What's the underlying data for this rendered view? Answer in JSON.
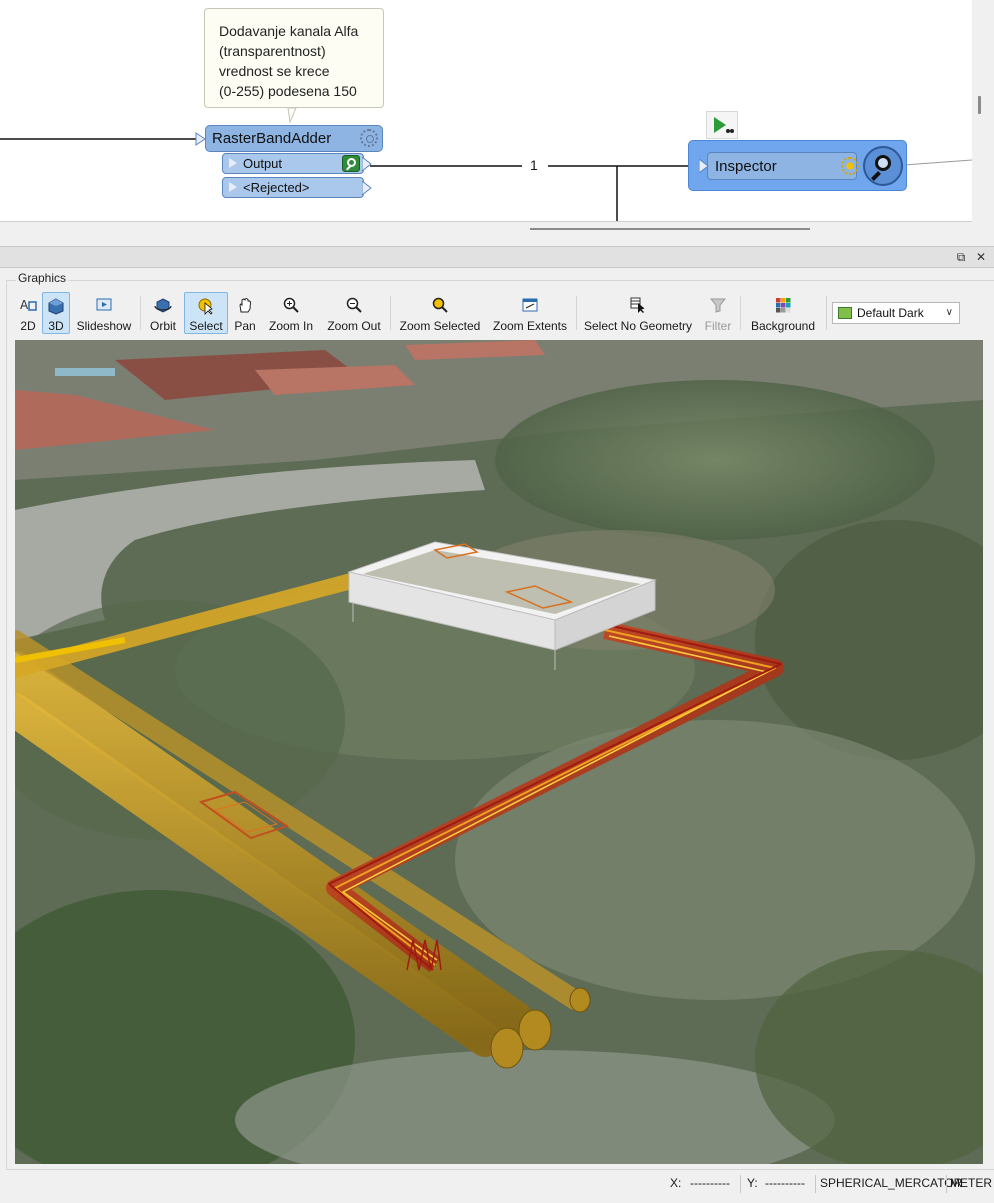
{
  "workflow": {
    "annotation": "Dodavanje kanala Alfa\n(transparentnost)\nvrednost se krece\n(0-255) podesena 150",
    "raster_band_adder": {
      "title": "RasterBandAdder",
      "ports": [
        "Output",
        "<Rejected>"
      ]
    },
    "connection_count": "1",
    "inspector": {
      "title": "Inspector"
    }
  },
  "graphics_panel": {
    "group_label": "Graphics",
    "toolbar": {
      "mode_2d": "2D",
      "mode_3d": "3D",
      "slideshow": "Slideshow",
      "orbit": "Orbit",
      "select": "Select",
      "pan": "Pan",
      "zoom_in": "Zoom In",
      "zoom_out": "Zoom Out",
      "zoom_selected": "Zoom Selected",
      "zoom_extents": "Zoom Extents",
      "select_no_geometry": "Select No Geometry",
      "filter": "Filter",
      "background": "Background"
    },
    "background_select": {
      "selected": "Default Dark"
    }
  },
  "status_bar": {
    "x_label": "X:",
    "x_value": "----------",
    "y_label": "Y:",
    "y_value": "----------",
    "projection": "SPHERICAL_MERCATOR",
    "units": "METER"
  },
  "colors": {
    "transformer_fill": "#8db4e2",
    "transformer_border": "#5a86bd",
    "pipe_yellow": "#c79a22",
    "pipe_red": "#c0321c",
    "selected_tool": "#cde4f7"
  }
}
